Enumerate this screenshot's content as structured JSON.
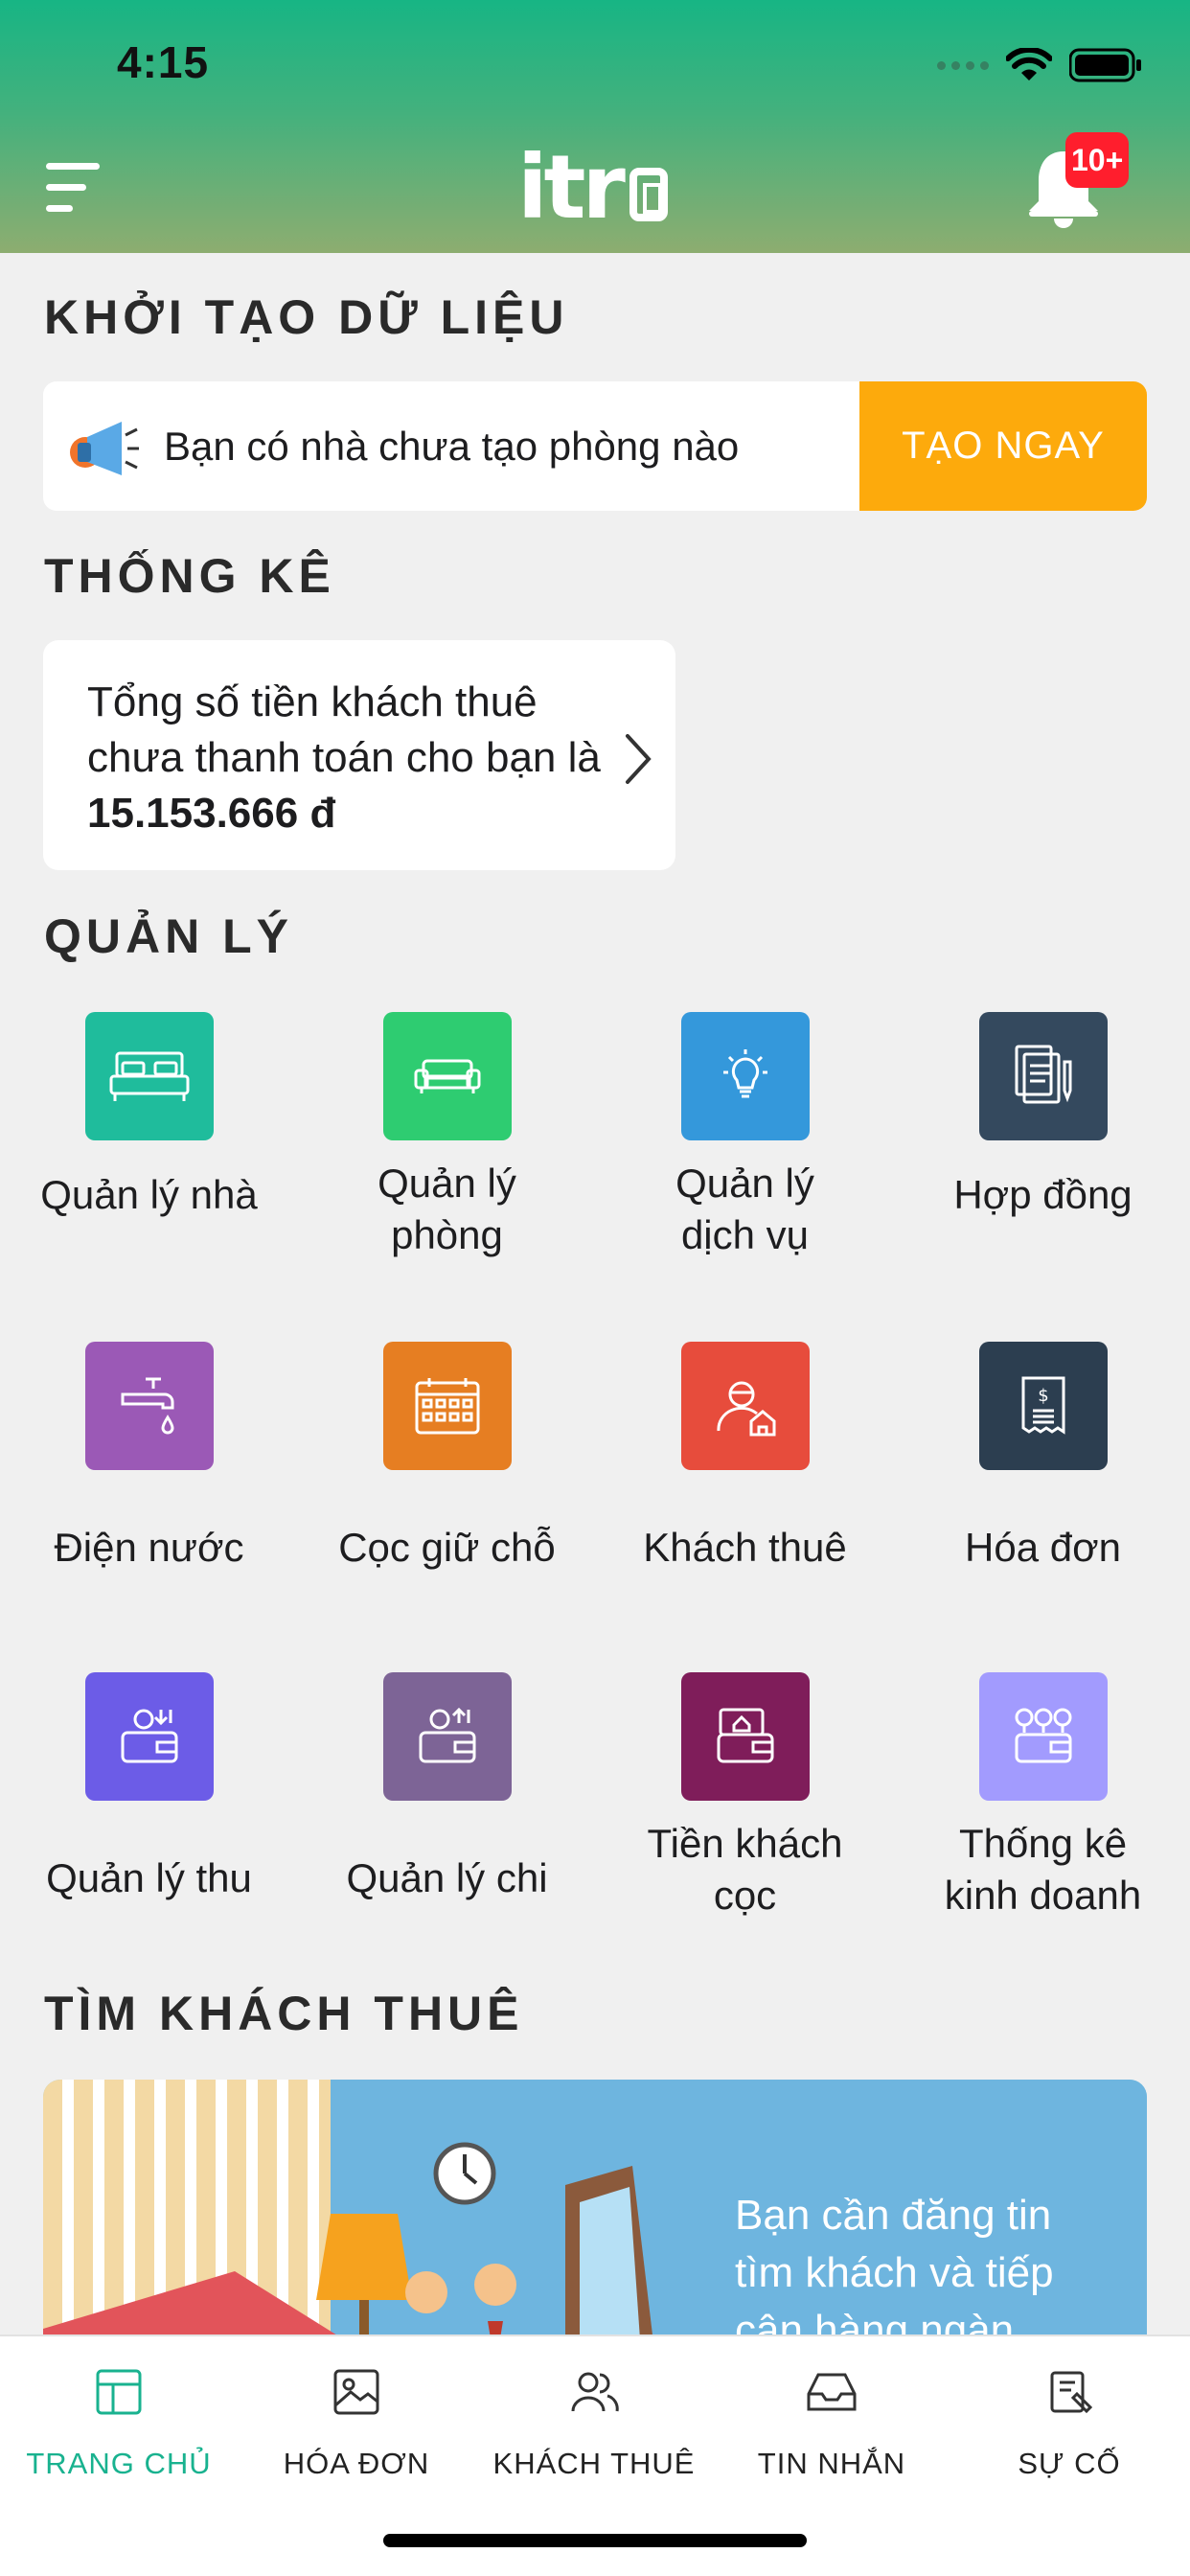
{
  "status_bar": {
    "time": "4:15"
  },
  "header": {
    "logo_text": "itr",
    "notification_badge": "10+"
  },
  "init_section": {
    "title": "KHỞI TẠO DỮ LIỆU",
    "message": "Bạn có nhà chưa tạo phòng nào",
    "button_label": "TẠO NGAY"
  },
  "stats_section": {
    "title": "THỐNG KÊ",
    "text": "Tổng số tiền khách thuê chưa thanh toán cho bạn là",
    "amount": "15.153.666 đ"
  },
  "manage_section": {
    "title": "QUẢN LÝ",
    "items": [
      {
        "label": "Quản lý nhà",
        "color": "#1fbc9c",
        "icon": "bed-icon"
      },
      {
        "label": "Quản lý phòng",
        "color": "#2ecc71",
        "icon": "sofa-icon"
      },
      {
        "label": "Quản lý dịch vụ",
        "color": "#3498db",
        "icon": "lightbulb-icon"
      },
      {
        "label": "Hợp đồng",
        "color": "#34495e",
        "icon": "contract-icon"
      },
      {
        "label": "Điện nước",
        "color": "#9b59b6",
        "icon": "faucet-icon"
      },
      {
        "label": "Cọc giữ chỗ",
        "color": "#e67e22",
        "icon": "calendar-icon"
      },
      {
        "label": "Khách thuê",
        "color": "#e74c3c",
        "icon": "tenant-icon"
      },
      {
        "label": "Hóa đơn",
        "color": "#2c3e50",
        "icon": "receipt-icon"
      },
      {
        "label": "Quản lý thu",
        "color": "#6c5ce7",
        "icon": "income-icon"
      },
      {
        "label": "Quản lý chi",
        "color": "#7d6496",
        "icon": "expense-icon"
      },
      {
        "label": "Tiền khách cọc",
        "color": "#7f1d5a",
        "icon": "deposit-wallet-icon"
      },
      {
        "label": "Thống kê kinh doanh",
        "color": "#a29bfe",
        "icon": "coins-wallet-icon"
      }
    ]
  },
  "find_section": {
    "title": "TÌM KHÁCH THUÊ",
    "banner_text": "Bạn cần đăng tin tìm khách và tiếp cận hàng ngàn"
  },
  "tabbar": {
    "tabs": [
      {
        "label": "TRANG CHỦ",
        "icon": "home-layout-icon",
        "active": true
      },
      {
        "label": "HÓA ĐƠN",
        "icon": "image-icon",
        "active": false
      },
      {
        "label": "KHÁCH THUÊ",
        "icon": "users-icon",
        "active": false
      },
      {
        "label": "TIN NHẮN",
        "icon": "inbox-icon",
        "active": false
      },
      {
        "label": "SỰ CỐ",
        "icon": "repair-icon",
        "active": false
      }
    ]
  },
  "colors": {
    "accent": "#19b28f",
    "header_top": "#17b584",
    "header_bottom": "#8dad70",
    "cta": "#fdaa0c",
    "badge": "#ff1e2d"
  }
}
